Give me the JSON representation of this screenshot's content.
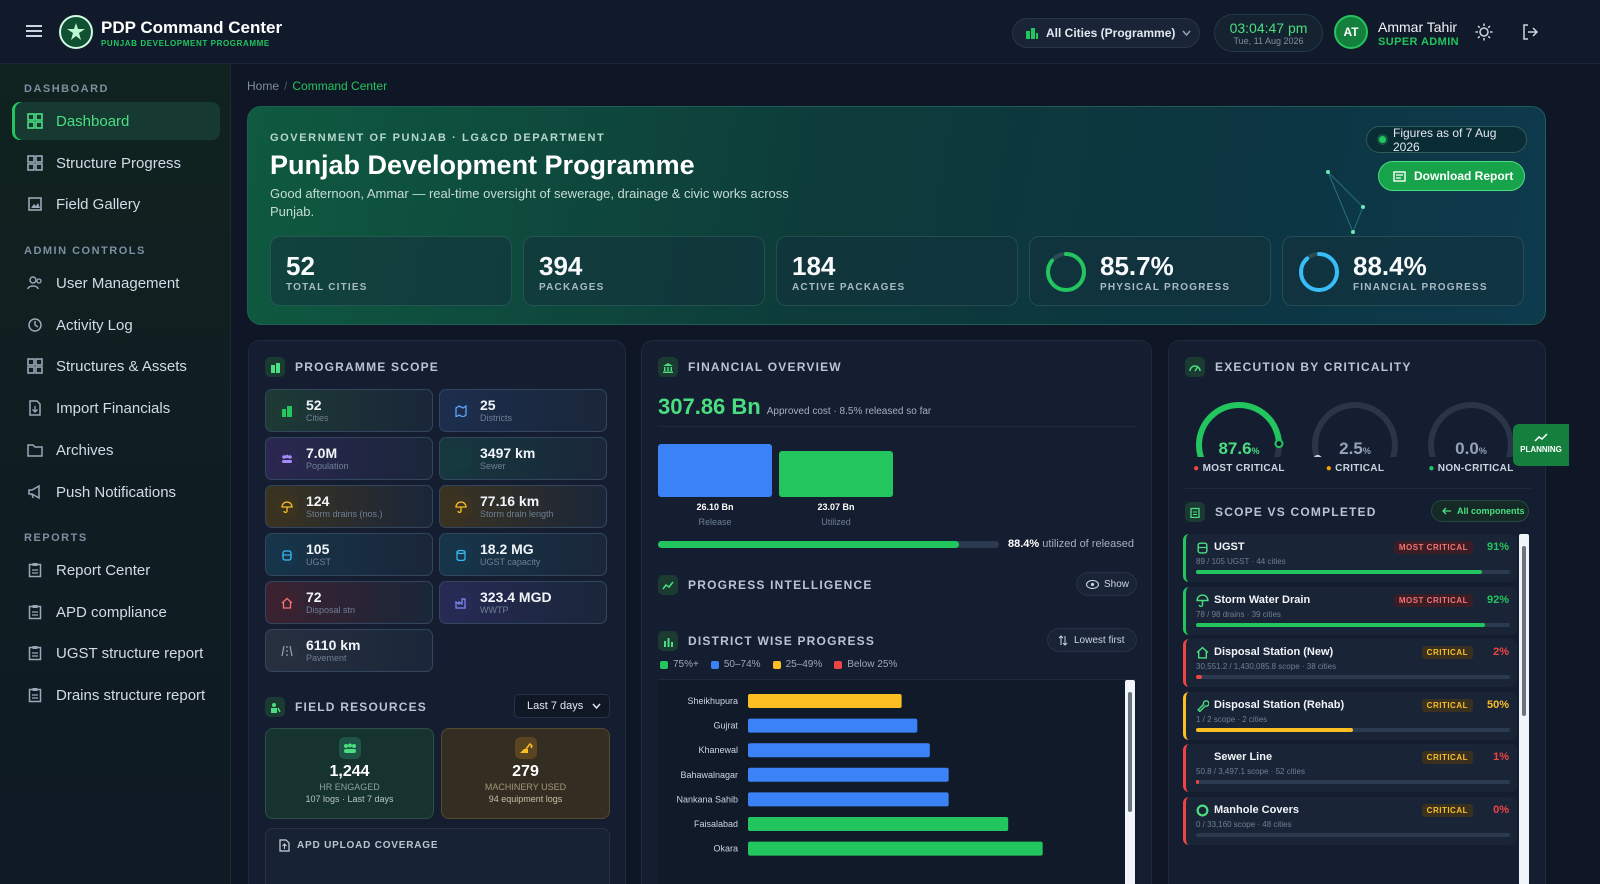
{
  "app": {
    "title": "PDP Command Center",
    "subtitle": "PUNJAB DEVELOPMENT PROGRAMME"
  },
  "topbar": {
    "city_select": "All Cities (Programme)",
    "time": "03:04:47 pm",
    "date": "Tue, 11 Aug 2026",
    "user_initials": "AT",
    "user_name": "Ammar Tahir",
    "user_role": "SUPER ADMIN"
  },
  "sidebar": {
    "sections": [
      {
        "label": "DASHBOARD",
        "items": [
          {
            "label": "Dashboard",
            "icon": "grid-icon",
            "active": true
          },
          {
            "label": "Structure Progress",
            "icon": "grid-icon"
          },
          {
            "label": "Field Gallery",
            "icon": "image-icon"
          }
        ]
      },
      {
        "label": "ADMIN CONTROLS",
        "items": [
          {
            "label": "User Management",
            "icon": "users-icon"
          },
          {
            "label": "Activity Log",
            "icon": "history-icon"
          },
          {
            "label": "Structures & Assets",
            "icon": "grid-icon"
          },
          {
            "label": "Import Financials",
            "icon": "file-import-icon"
          },
          {
            "label": "Archives",
            "icon": "folder-icon"
          },
          {
            "label": "Push Notifications",
            "icon": "megaphone-icon"
          }
        ]
      },
      {
        "label": "REPORTS",
        "items": [
          {
            "label": "Report Center",
            "icon": "clipboard-icon"
          },
          {
            "label": "APD compliance",
            "icon": "clipboard-icon"
          },
          {
            "label": "UGST structure report",
            "icon": "clipboard-icon"
          },
          {
            "label": "Drains structure report",
            "icon": "clipboard-icon"
          }
        ]
      }
    ]
  },
  "breadcrumb": {
    "home": "Home",
    "sep": "/",
    "current": "Command Center"
  },
  "hero": {
    "kicker": "GOVERNMENT OF PUNJAB · LG&CD DEPARTMENT",
    "title": "Punjab Development Programme",
    "greeting": "Good afternoon, Ammar — real-time oversight of sewerage, drainage & civic works across Punjab.",
    "figures_as_of": "Figures as of 7 Aug 2026",
    "download": "Download Report",
    "stats": [
      {
        "value": "52",
        "label": "TOTAL CITIES"
      },
      {
        "value": "394",
        "label": "PACKAGES"
      },
      {
        "value": "184",
        "label": "ACTIVE PACKAGES"
      },
      {
        "value": "85.7%",
        "label": "PHYSICAL PROGRESS",
        "ring": 0.857,
        "color": "#22c55e"
      },
      {
        "value": "88.4%",
        "label": "FINANCIAL PROGRESS",
        "ring": 0.884,
        "color": "#38bdf8"
      }
    ]
  },
  "scope": {
    "title": "PROGRAMME SCOPE",
    "tiles": [
      {
        "value": "52",
        "label": "Cities",
        "icon": "building-icon",
        "color": "#22c55e",
        "bg": "#1d3a34"
      },
      {
        "value": "25",
        "label": "Districts",
        "icon": "map-icon",
        "color": "#60a5fa",
        "bg": "#1c2e4d"
      },
      {
        "value": "7.0M",
        "label": "Population",
        "icon": "people-icon",
        "color": "#a78bfa",
        "bg": "#2a2750"
      },
      {
        "value": "3497 km",
        "label": "Sewer",
        "icon": "drop-icon",
        "color": "#2dd4bf",
        "bg": "#16383f"
      },
      {
        "value": "124",
        "label": "Storm drains (nos.)",
        "icon": "umbrella-icon",
        "color": "#fbbf24",
        "bg": "#3b3320"
      },
      {
        "value": "77.16 km",
        "label": "Storm drain length",
        "icon": "umbrella-icon",
        "color": "#fbbf24",
        "bg": "#3b3320"
      },
      {
        "value": "105",
        "label": "UGST",
        "icon": "tank-icon",
        "color": "#38bdf8",
        "bg": "#16354a"
      },
      {
        "value": "18.2 MG",
        "label": "UGST capacity",
        "icon": "cylinder-icon",
        "color": "#38bdf8",
        "bg": "#16354a"
      },
      {
        "value": "72",
        "label": "Disposal stn",
        "icon": "home-icon",
        "color": "#f87171",
        "bg": "#3b2230"
      },
      {
        "value": "323.4 MGD",
        "label": "WWTP",
        "icon": "factory-icon",
        "color": "#818cf8",
        "bg": "#262a55"
      },
      {
        "value": "6110 km",
        "label": "Pavement",
        "icon": "road-icon",
        "color": "#94a3b8",
        "bg": "#27303f"
      }
    ]
  },
  "field": {
    "title": "FIELD RESOURCES",
    "range": "Last 7 days",
    "hr": {
      "value": "1,244",
      "label": "HR ENGAGED",
      "sub": "107 logs · Last 7 days"
    },
    "mach": {
      "value": "279",
      "label": "MACHINERY USED",
      "sub": "94 equipment logs"
    },
    "apd": "APD UPLOAD COVERAGE"
  },
  "financial": {
    "title": "FINANCIAL OVERVIEW",
    "total": "307.86 Bn",
    "total_note": "Approved cost · 8.5% released so far",
    "release": {
      "value": "26.10 Bn",
      "label": "Release"
    },
    "utilized": {
      "value": "23.07 Bn",
      "label": "Utilized"
    },
    "util_pct": "88.4%",
    "util_text": "utilized of released",
    "util_frac": 0.884
  },
  "intel": {
    "title": "PROGRESS INTELLIGENCE",
    "show": "Show"
  },
  "district": {
    "title": "DISTRICT WISE PROGRESS",
    "sort": "Lowest first",
    "legend": [
      {
        "label": "75%+",
        "color": "#22c55e"
      },
      {
        "label": "50–74%",
        "color": "#3b82f6"
      },
      {
        "label": "25–49%",
        "color": "#fbbf24"
      },
      {
        "label": "Below 25%",
        "color": "#ef4444"
      }
    ]
  },
  "chart_data": {
    "type": "bar",
    "orientation": "horizontal",
    "categories": [
      "Sheikhupura",
      "Gujrat",
      "Khanewal",
      "Bahawalnagar",
      "Nankana Sahib",
      "Faisalabad",
      "Okara"
    ],
    "values": [
      49,
      54,
      58,
      64,
      64,
      83,
      94
    ],
    "colors": [
      "#fbbf24",
      "#3b82f6",
      "#3b82f6",
      "#3b82f6",
      "#3b82f6",
      "#22c55e",
      "#22c55e"
    ],
    "xlim": [
      0,
      100
    ]
  },
  "criticality": {
    "title": "EXECUTION BY CRITICALITY",
    "planning": "PLANNING",
    "gauges": [
      {
        "value": "87.6",
        "unit": "%",
        "label": "MOST CRITICAL",
        "frac": 0.876,
        "color": "#22c55e",
        "dot": "#ef4444"
      },
      {
        "value": "2.5",
        "unit": "%",
        "label": "CRITICAL",
        "frac": 0.025,
        "color": "#94a3b8",
        "dot": "#f59e0b"
      },
      {
        "value": "0.0",
        "unit": "%",
        "label": "NON-CRITICAL",
        "frac": 0.0,
        "color": "#94a3b8",
        "dot": "#22c55e"
      }
    ]
  },
  "scope_vs": {
    "title": "SCOPE VS COMPLETED",
    "all": "All components",
    "rows": [
      {
        "name": "UGST",
        "sub": "89 / 105 UGST · 44 cities",
        "badge": "MOST CRITICAL",
        "pct": "91%",
        "frac": 0.91,
        "color": "#22c55e",
        "icon": "tank-icon"
      },
      {
        "name": "Storm Water Drain",
        "sub": "78 / 98 drains · 39 cities",
        "badge": "MOST CRITICAL",
        "pct": "92%",
        "frac": 0.92,
        "color": "#22c55e",
        "icon": "umbrella-icon"
      },
      {
        "name": "Disposal Station (New)",
        "sub": "30,551.2 / 1,430,085.8 scope · 38 cities",
        "badge": "CRITICAL",
        "pct": "2%",
        "frac": 0.02,
        "color": "#ef4444",
        "icon": "home-icon"
      },
      {
        "name": "Disposal Station (Rehab)",
        "sub": "1 / 2 scope · 2 cities",
        "badge": "CRITICAL",
        "pct": "50%",
        "frac": 0.5,
        "color": "#fbbf24",
        "icon": "wrench-icon"
      },
      {
        "name": "Sewer Line",
        "sub": "50.8 / 3,497.1 scope · 52 cities",
        "badge": "CRITICAL",
        "pct": "1%",
        "frac": 0.01,
        "color": "#ef4444",
        "icon": "drop-icon"
      },
      {
        "name": "Manhole Covers",
        "sub": "0 / 33,160 scope · 48 cities",
        "badge": "CRITICAL",
        "pct": "0%",
        "frac": 0.0,
        "color": "#ef4444",
        "icon": "circle-icon"
      }
    ]
  }
}
